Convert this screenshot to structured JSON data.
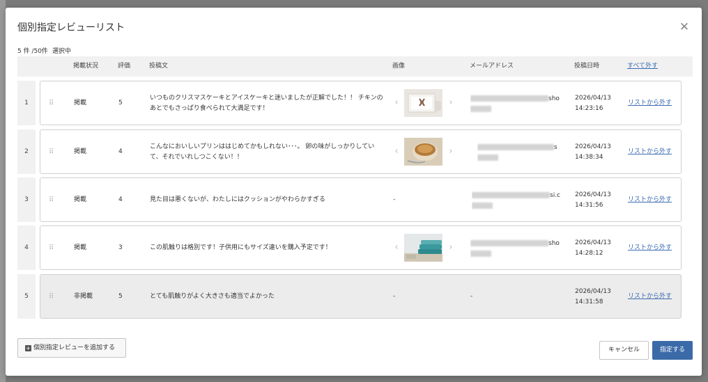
{
  "modal": {
    "title": "個別指定レビューリスト",
    "close_icon": "close-icon",
    "selection_count": "5 件 /50件",
    "selection_label": "選択中"
  },
  "table": {
    "headers": {
      "status": "掲載状況",
      "rating": "評価",
      "text": "投稿文",
      "image": "画像",
      "email": "メールアドレス",
      "date": "投稿日時",
      "remove_all": "すべて外す"
    },
    "rows": [
      {
        "num": "1",
        "status": "掲載",
        "rating": "5",
        "text": "いつものクリスマスケーキとアイスケーキと迷いましたが正解でした！！ チキンのあとでもさっぱり食べられて大満足です！",
        "image": "gift-box",
        "email_suffix": "sho",
        "date1": "2026/04/13",
        "date2": "14:23:16",
        "remove": "リストから外す"
      },
      {
        "num": "2",
        "status": "掲載",
        "rating": "4",
        "text": "こんなにおいしいプリンははじめてかもしれない･･･。 卵の味がしっかりしていて、それでいれしつこくない！！",
        "image": "pudding",
        "email_suffix": "s",
        "date1": "2026/04/13",
        "date2": "14:38:34",
        "remove": "リストから外す"
      },
      {
        "num": "3",
        "status": "掲載",
        "rating": "4",
        "text": "見た目は悪くないが、わたしにはクッションがやわらかすぎる",
        "image": "-",
        "email_suffix": "si.c",
        "date1": "2026/04/13",
        "date2": "14:31:56",
        "remove": "リストから外す"
      },
      {
        "num": "4",
        "status": "掲載",
        "rating": "3",
        "text": "この肌触りは格別です！子供用にもサイズ違いを購入予定です！",
        "image": "towels",
        "email_suffix": "sho",
        "date1": "2026/04/13",
        "date2": "14:28:12",
        "remove": "リストから外す"
      },
      {
        "num": "5",
        "status": "非掲載",
        "rating": "5",
        "text": "とても肌触りがよく大きさも適当でよかった",
        "image": "-",
        "email": "-",
        "date1": "2026/04/13",
        "date2": "14:31:58",
        "remove": "リストから外す"
      }
    ]
  },
  "footer": {
    "add_label": "個別指定レビューを追加する",
    "cancel_label": "キャンセル",
    "submit_label": "指定する"
  },
  "colors": {
    "accent": "#3b6aa8",
    "link": "#3a6bb0",
    "header_bg": "#f1f1f1",
    "disabled_row_bg": "#ececec"
  }
}
